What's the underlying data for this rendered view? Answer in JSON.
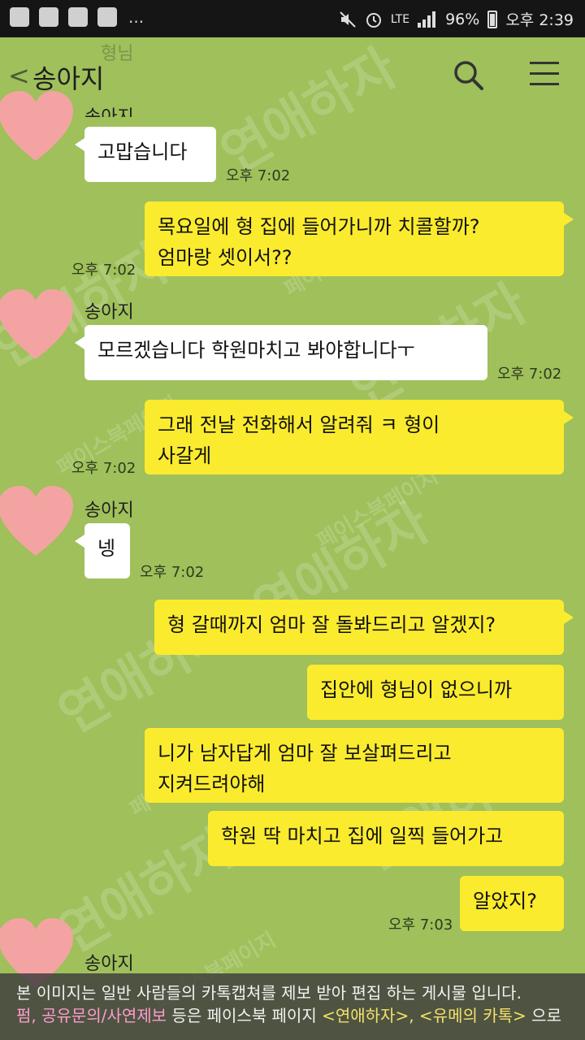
{
  "statusbar": {
    "icons_left": [
      "app-icon",
      "image-icon",
      "v-app-icon",
      "message-icon"
    ],
    "more": "...",
    "network": "LTE",
    "battery": "96%",
    "time": "오후 2:39"
  },
  "header": {
    "back": "<",
    "title": "송아지",
    "faded_text": "형님"
  },
  "messages": {
    "m1_name": "송아지",
    "m1_text": "고맙습니다",
    "m1_time": "오후 7:02",
    "m2_text": "목요일에 형 집에 들어가니까 치콜할까?\n엄마랑 셋이서??",
    "m2_time": "오후 7:02",
    "m3_name": "송아지",
    "m3_text": "모르겠습니다 학원마치고 봐야합니다ㅜ",
    "m3_time": "오후 7:02",
    "m4_text": "그래 전날 전화해서 알려줘 ㅋ 형이\n사갈게",
    "m4_time": "오후 7:02",
    "m5_name": "송아지",
    "m5_text": "넹",
    "m5_time": "오후 7:02",
    "m6_text": "형 갈때까지 엄마 잘 돌봐드리고 알겠지?",
    "m7_text": "집안에 형님이 없으니까",
    "m8_text": "니가 남자답게 엄마 잘 보살펴드리고\n지켜드려야해",
    "m9_text": "학원 딱 마치고 집에 일찍 들어가고",
    "m10_text": "알았지?",
    "m10_time": "오후 7:03",
    "m11_name": "송아지"
  },
  "watermark": {
    "big": "연애하자",
    "small": "페이스북페이지"
  },
  "notice": {
    "line1": "본 이미지는 일반 사람들의 카톡캡쳐를 제보 받아 편집 하는 게시물 입니다.",
    "line2_pink": "펌, 공유문의/사연제보",
    "line2_mid": " 등은 페이스북 페이지 ",
    "line2_yellow": "<연애하자>, <유메의 카톡>",
    "line2_end": " 으로"
  },
  "colors": {
    "chat_bg": "#9fc05b",
    "my_bubble": "#fbeb2e",
    "their_bubble": "#ffffff",
    "statusbar": "#151515"
  }
}
